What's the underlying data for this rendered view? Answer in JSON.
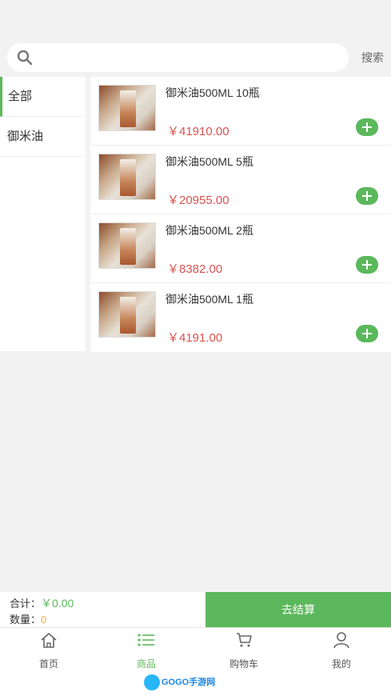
{
  "search": {
    "button_label": "搜索"
  },
  "sidebar": {
    "items": [
      {
        "label": "全部"
      },
      {
        "label": "御米油"
      }
    ]
  },
  "products": [
    {
      "title": "御米油500ML 10瓶",
      "price": "￥41910.00"
    },
    {
      "title": "御米油500ML 5瓶",
      "price": "￥20955.00"
    },
    {
      "title": "御米油500ML 2瓶",
      "price": "￥8382.00"
    },
    {
      "title": "御米油500ML 1瓶",
      "price": "￥4191.00"
    }
  ],
  "cart": {
    "total_label": "合计：",
    "total_value": "￥0.00",
    "count_label": "数量：",
    "count_value": "0",
    "checkout_label": "去结算"
  },
  "tabs": [
    {
      "label": "首页",
      "icon": "home-icon"
    },
    {
      "label": "商品",
      "icon": "list-icon"
    },
    {
      "label": "购物车",
      "icon": "cart-icon"
    },
    {
      "label": "我的",
      "icon": "user-icon"
    }
  ],
  "watermark": {
    "text": "GOGO手游网"
  },
  "colors": {
    "accent": "#5cb85c",
    "price": "#d9534f",
    "count": "#f0ad4e"
  }
}
